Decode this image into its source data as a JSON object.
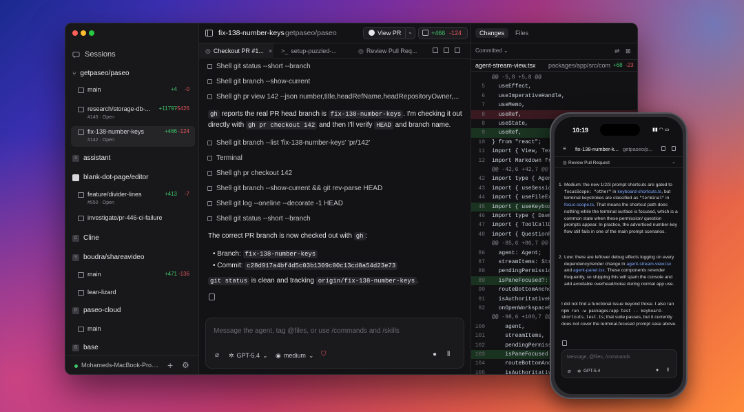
{
  "sidebar": {
    "sessions_label": "Sessions",
    "groups": [
      {
        "name": "getpaseo/paseo",
        "badge": ""
      },
      {
        "name": "assistant",
        "badge": "A"
      },
      {
        "name": "blank-dot-page/editor",
        "badge": ""
      },
      {
        "name": "Cline",
        "badge": "C"
      },
      {
        "name": "boudra/shareavideo",
        "badge": "S"
      },
      {
        "name": "paseo-cloud",
        "badge": "P"
      },
      {
        "name": "base",
        "badge": "B"
      }
    ],
    "items": [
      {
        "name": "main",
        "sub": "",
        "add": "+4",
        "del": "-0"
      },
      {
        "name": "research/storage-db-...",
        "sub": "#145 · Open",
        "add": "+11797",
        "del": "-5426"
      },
      {
        "name": "fix-138-number-keys",
        "sub": "#142 · Open",
        "add": "+466",
        "del": "-124"
      },
      {
        "name": "feature/divider-lines",
        "sub": "#550 · Open",
        "add": "+413",
        "del": "-7"
      },
      {
        "name": "investigate/pr-446-ci-failure",
        "sub": "",
        "add": "",
        "del": ""
      },
      {
        "name": "main",
        "sub": "",
        "add": "+471",
        "del": "-136"
      },
      {
        "name": "lean-lizard",
        "sub": "",
        "add": "",
        "del": ""
      },
      {
        "name": "main",
        "sub": "",
        "add": "",
        "del": ""
      }
    ],
    "host": "Mohameds-MacBook-Pro...."
  },
  "header": {
    "branch": "fix-138-number-keys",
    "repo": "getpaseo/paseo",
    "view_pr": "View PR",
    "diff_add": "+466",
    "diff_del": "-124"
  },
  "tabs": [
    {
      "label": "Checkout PR #1..."
    },
    {
      "label": "setup-puzzled-..."
    },
    {
      "label": "Review Pull Req..."
    }
  ],
  "transcript": {
    "tools": [
      "Shell  git status --short --branch",
      "Shell  git branch --show-current",
      "Shell  gh pr view 142 --json number,title,headRefName,headRepositoryOwner,...",
      "Shell  git branch --list 'fix-138-number-keys' 'pr/142'",
      "Terminal",
      "Shell  gh pr checkout 142",
      "Shell  git branch --show-current && git rev-parse HEAD",
      "Shell  git log --oneline --decorate -1 HEAD",
      "Shell  git status --short --branch"
    ],
    "msg1": {
      "t1": "gh",
      "t2": " reports the real PR head branch is ",
      "t3": "fix-138-number-keys",
      "t4": ". I'm checking it out directly with ",
      "t5": "gh pr checkout 142",
      "t6": " and then I'll verify ",
      "t7": "HEAD",
      "t8": " and branch name."
    },
    "msg2": {
      "t1": "The correct PR branch is now checked out with ",
      "t2": "gh",
      "t3": ":"
    },
    "bullet1_label": "Branch: ",
    "bullet1_value": "fix-138-number-keys",
    "bullet2_label": "Commit: ",
    "bullet2_value": "c28d917a4bf4d5c03b1309c00c13cd8a54d23e73",
    "msg3": {
      "t1": "git status",
      "t2": " is clean and tracking ",
      "t3": "origin/fix-138-number-keys",
      "t4": "."
    }
  },
  "composer": {
    "placeholder": "Message the agent, tag @files, or use /commands and /skills",
    "model": "GPT-5.4",
    "effort": "medium"
  },
  "diff_panel": {
    "tab_changes": "Changes",
    "tab_files": "Files",
    "filter": "Committed",
    "file_name": "agent-stream-view.tsx",
    "file_path": "packages/app/src/compo...",
    "file_add": "+68",
    "file_del": "-23",
    "lines": [
      {
        "ln": "",
        "text": "@@ -5,8 +5,8 @@",
        "kind": "hunk"
      },
      {
        "ln": "5",
        "text": "  useEffect,",
        "kind": ""
      },
      {
        "ln": "6",
        "text": "  useImperativeHandle,",
        "kind": ""
      },
      {
        "ln": "7",
        "text": "  useMemo,",
        "kind": ""
      },
      {
        "ln": "8",
        "text": "  useRef,",
        "kind": "del"
      },
      {
        "ln": "8",
        "text": "  useState,",
        "kind": ""
      },
      {
        "ln": "9",
        "text": "  useRef,",
        "kind": "add"
      },
      {
        "ln": "10",
        "text": "} from \"react\";",
        "kind": ""
      },
      {
        "ln": "11",
        "text": "import { View, Text,",
        "kind": ""
      },
      {
        "ln": "12",
        "text": "import Markdown from",
        "kind": ""
      },
      {
        "ln": "",
        "text": "@@ -42,6 +42,7 @@",
        "kind": "hunk"
      },
      {
        "ln": "42",
        "text": "import type { Agent",
        "kind": ""
      },
      {
        "ln": "43",
        "text": "import { useSession",
        "kind": ""
      },
      {
        "ln": "44",
        "text": "import { useFileExpl",
        "kind": ""
      },
      {
        "ln": "45",
        "text": "import { useKeyboard",
        "kind": "add"
      },
      {
        "ln": "46",
        "text": "import type { Daemon",
        "kind": ""
      },
      {
        "ln": "47",
        "text": "import { ToolCallDet",
        "kind": ""
      },
      {
        "ln": "48",
        "text": "import { QuestionFor",
        "kind": ""
      },
      {
        "ln": "",
        "text": "@@ -85,6 +86,7 @@",
        "kind": "hunk"
      },
      {
        "ln": "86",
        "text": "  agent: Agent;",
        "kind": ""
      },
      {
        "ln": "87",
        "text": "  streamItems: Strea",
        "kind": ""
      },
      {
        "ln": "88",
        "text": "  pendingPermissions",
        "kind": ""
      },
      {
        "ln": "89",
        "text": "  isPaneFocused?: bo",
        "kind": "add"
      },
      {
        "ln": "90",
        "text": "  routeBottomAnchorR",
        "kind": ""
      },
      {
        "ln": "91",
        "text": "  isAuthoritativeHis",
        "kind": ""
      },
      {
        "ln": "92",
        "text": "  onOpenWorkspaceFil",
        "kind": ""
      },
      {
        "ln": "",
        "text": "@@ -98,6 +100,7 @@",
        "kind": "hunk"
      },
      {
        "ln": "100",
        "text": "    agent,",
        "kind": ""
      },
      {
        "ln": "101",
        "text": "    streamItems,",
        "kind": ""
      },
      {
        "ln": "102",
        "text": "    pendingPermiss",
        "kind": ""
      },
      {
        "ln": "103",
        "text": "    isPaneFocused",
        "kind": "add"
      },
      {
        "ln": "104",
        "text": "    routeBottomAnc",
        "kind": ""
      },
      {
        "ln": "105",
        "text": "    isAuthoritativ",
        "kind": ""
      }
    ]
  },
  "phone": {
    "time": "10:19",
    "title": "fix-138-number-k...",
    "repo": "getpaseo/p...",
    "tab": "Review Pull Request",
    "item1": {
      "a": "Medium: the new 1/2/3 prompt shortcuts are gated to ",
      "b": "focusScope: \"other\"",
      "c": " in ",
      "d": "keyboard-shortcuts.ts",
      "e": ", but terminal keystrokes are classified as ",
      "f": "\"terminal\"",
      "g": " in ",
      "h": "focus-scope.ts",
      "i": ". That means the shortcut path does nothing while the terminal surface is focused, which is a common state when these permission/ question prompts appear. In practice, the advertised number-key flow still fails in one of the main prompt scenarios."
    },
    "item2": {
      "a": "Low: there are leftover debug effects logging on every dependency/render change in ",
      "b": "agent-stream-view.tsx",
      "c": " and ",
      "d": "agent-panel.tsx",
      "e": ". These components rerender frequently, so shipping this will spam the console and add avoidable overhead/noise during normal app use."
    },
    "outro": {
      "a": "I did not find a functional issue beyond those. I also ran ",
      "b": "npm run -w packages/app test -- keyboard-shortcuts.test.ts",
      "c": "; that suite passes, but it currently does not cover the terminal-focused prompt case above."
    },
    "placeholder": "Message, @files, /commands",
    "model": "GPT-5.4"
  }
}
